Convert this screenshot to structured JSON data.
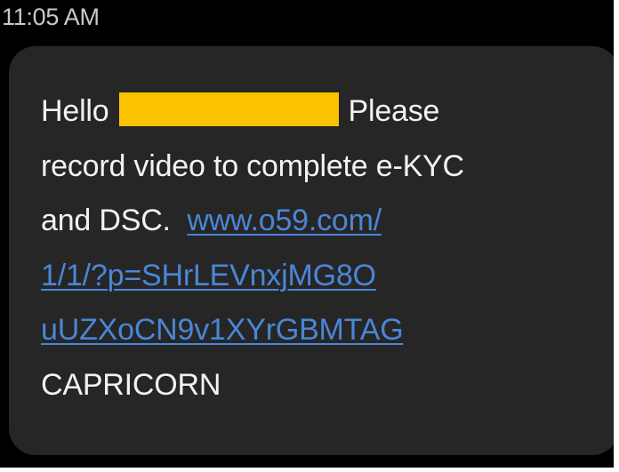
{
  "status_bar": {
    "time": "11:05 AM"
  },
  "message": {
    "greeting": "Hello",
    "after_name": "Please",
    "body_line_2": "record video to complete e-KYC",
    "body_line_3_text": "and DSC.",
    "link_lines": [
      "www.o59.com/",
      "1/1/?p=SHrLEVnxjMG8O",
      "uUZXoCN9v1XYrGBMTAG"
    ],
    "sender_tag": "CAPRICORN"
  },
  "colors": {
    "background": "#000000",
    "bubble": "#262626",
    "text": "#f2f2f2",
    "link": "#4a86d6",
    "redaction": "#fbc300"
  }
}
